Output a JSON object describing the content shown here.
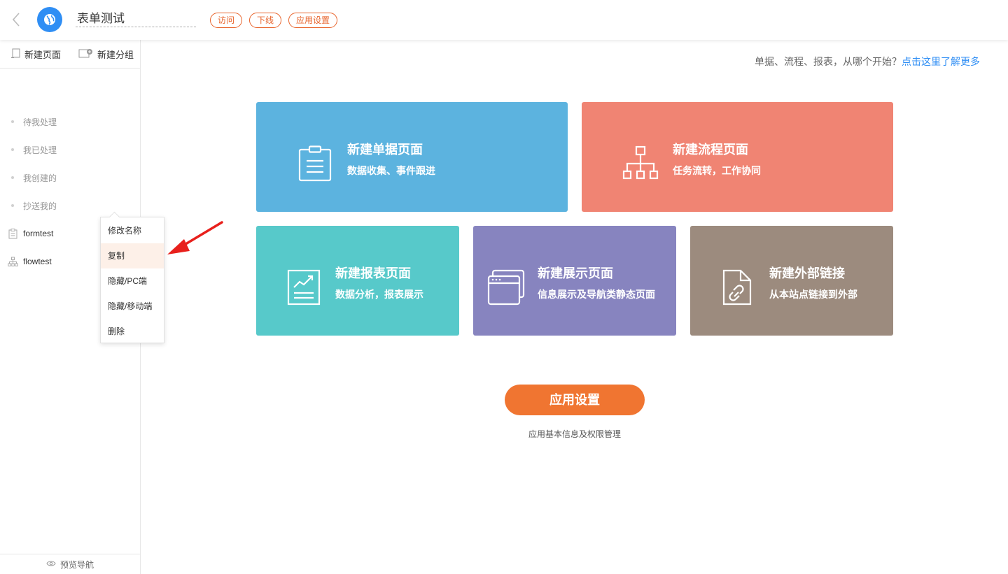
{
  "header": {
    "title": "表单测试",
    "buttons": {
      "visit": "访问",
      "offline": "下线",
      "app_settings": "应用设置"
    }
  },
  "sidebar": {
    "actions": {
      "new_page": "新建页面",
      "new_group": "新建分组"
    },
    "items": [
      {
        "label": "待我处理"
      },
      {
        "label": "我已处理"
      },
      {
        "label": "我创建的"
      },
      {
        "label": "抄送我的"
      }
    ],
    "pages": [
      {
        "label": "formtest",
        "icon": "form-icon"
      },
      {
        "label": "flowtest",
        "icon": "flow-icon"
      }
    ],
    "footer": "预览导航"
  },
  "context_menu": {
    "items": [
      "修改名称",
      "复制",
      "隐藏/PC端",
      "隐藏/移动端",
      "删除"
    ],
    "active_index": 1
  },
  "main": {
    "hint_text": "单据、流程、报表，从哪个开始？",
    "hint_link": "点击这里了解更多",
    "cards": [
      {
        "title": "新建单据页面",
        "sub": "数据收集、事件跟进",
        "color": "#5cb3df",
        "icon": "clipboard-icon"
      },
      {
        "title": "新建流程页面",
        "sub": "任务流转，工作协同",
        "color": "#f08473",
        "icon": "flow-chart-icon"
      },
      {
        "title": "新建报表页面",
        "sub": "数据分析，报表展示",
        "color": "#57c9ca",
        "icon": "report-chart-icon"
      },
      {
        "title": "新建展示页面",
        "sub": "信息展示及导航类静态页面",
        "color": "#8784bf",
        "icon": "browser-window-icon"
      },
      {
        "title": "新建外部链接",
        "sub": "从本站点链接到外部",
        "color": "#9c8b7e",
        "icon": "external-link-doc-icon"
      }
    ],
    "cta": {
      "label": "应用设置",
      "sub": "应用基本信息及权限管理",
      "color": "#f07531"
    }
  },
  "colors": {
    "accent": "#e8642c",
    "link": "#2f8ef4",
    "annotation_arrow": "#e8201c"
  }
}
